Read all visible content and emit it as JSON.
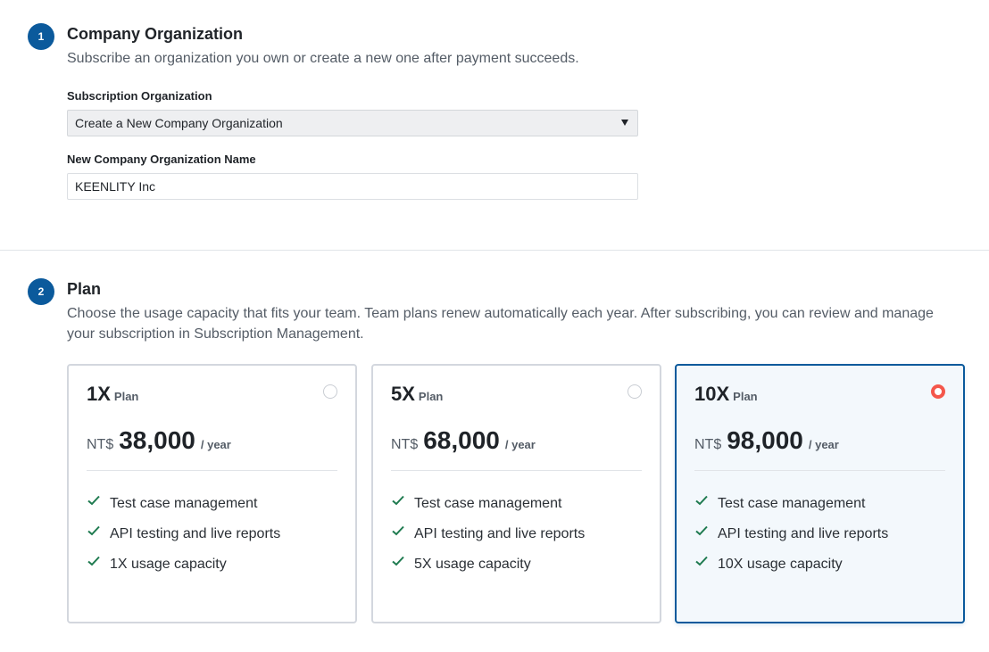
{
  "section1": {
    "step": "1",
    "title": "Company Organization",
    "description": "Subscribe an organization you own or create a new one after payment succeeds.",
    "subscription_org_label": "Subscription Organization",
    "subscription_org_value": "Create a New Company Organization",
    "new_org_name_label": "New Company Organization Name",
    "new_org_name_value": "KEENLITY Inc"
  },
  "section2": {
    "step": "2",
    "title": "Plan",
    "description_line1": "Choose the usage capacity that fits your team. Team plans renew automatically each year. After subscribing, you can review and manage",
    "description_line2": "your subscription in Subscription Management.",
    "plans": [
      {
        "name": "1X",
        "tag": "Plan",
        "currency": "NT$",
        "amount": "38,000",
        "period": "/ year",
        "selected": false,
        "features": [
          "Test case management",
          "API testing and live reports",
          "1X usage capacity"
        ]
      },
      {
        "name": "5X",
        "tag": "Plan",
        "currency": "NT$",
        "amount": "68,000",
        "period": "/ year",
        "selected": false,
        "features": [
          "Test case management",
          "API testing and live reports",
          "5X usage capacity"
        ]
      },
      {
        "name": "10X",
        "tag": "Plan",
        "currency": "NT$",
        "amount": "98,000",
        "period": "/ year",
        "selected": true,
        "features": [
          "Test case management",
          "API testing and live reports",
          "10X usage capacity"
        ]
      }
    ]
  },
  "colors": {
    "accent": "#0b5a9c",
    "radio_selected": "#f4574b",
    "check": "#1e7a4f"
  }
}
